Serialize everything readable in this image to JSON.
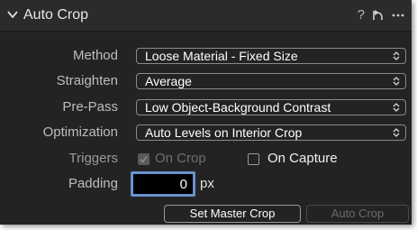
{
  "panel": {
    "title": "Auto Crop",
    "help": "?",
    "icons": {
      "collapse": "chevron-down-icon",
      "reset": "reset-arrow-icon",
      "more": "ellipsis-icon"
    }
  },
  "settings": {
    "method": {
      "label": "Method",
      "value": "Loose Material - Fixed Size"
    },
    "straighten": {
      "label": "Straighten",
      "value": "Average"
    },
    "prepass": {
      "label": "Pre-Pass",
      "value": "Low Object-Background Contrast"
    },
    "optimization": {
      "label": "Optimization",
      "value": "Auto Levels on Interior Crop"
    }
  },
  "triggers": {
    "label": "Triggers",
    "on_crop": {
      "label": "On Crop",
      "checked": true,
      "enabled": false
    },
    "on_capture": {
      "label": "On Capture",
      "checked": false,
      "enabled": true
    }
  },
  "padding": {
    "label": "Padding",
    "value": "0",
    "unit": "px"
  },
  "buttons": {
    "set_master_crop": "Set Master Crop",
    "auto_crop": "Auto Crop"
  },
  "colors": {
    "focus_ring": "#6b91cf",
    "panel_bg": "#232323"
  }
}
